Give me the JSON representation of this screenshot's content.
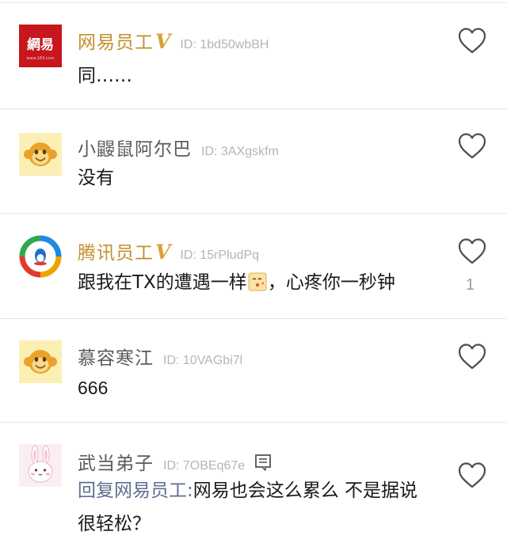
{
  "comments": [
    {
      "username": "网易员工",
      "verified_badge": "V",
      "user_id": "ID: 1bd50wbBH",
      "text": "同……",
      "avatar": "netease-logo-icon",
      "avatar_text": "網易",
      "avatar_subtext": "www.163.com",
      "like_count": ""
    },
    {
      "username": "小鼹鼠阿尔巴",
      "user_id": "ID: 3AXgskfm",
      "text": "没有",
      "avatar": "monkey-avatar-icon",
      "like_count": ""
    },
    {
      "username": "腾讯员工",
      "verified_badge": "V",
      "user_id": "ID: 15rPludPq",
      "text_before_emoji": "跟我在TX的遭遇一样",
      "emoji": "kiss-emoji-icon",
      "text_after_emoji": "，心疼你一秒钟",
      "avatar": "tencent-news-logo-icon",
      "like_count": "1"
    },
    {
      "username": "慕容寒江",
      "user_id": "ID: 10VAGbi7l",
      "text": "666",
      "avatar": "monkey-avatar-icon",
      "like_count": ""
    },
    {
      "username": "武当弟子",
      "user_id": "ID: 7OBEq67e",
      "reply_prefix": "回复网易员工:",
      "text_line1": "网易也会这么累么 不是据说",
      "text_line2": "很轻松？",
      "avatar": "rabbit-avatar-icon",
      "like_count": ""
    }
  ],
  "colors": {
    "verified_name": "#c2902e",
    "verified_badge": "#d9a232",
    "username": "#5a5a5a",
    "user_id": "#b5b5b5",
    "reply_prefix": "#5e6f8f",
    "netease_red": "#c8161d",
    "monkey_background": "#fcefb3"
  }
}
